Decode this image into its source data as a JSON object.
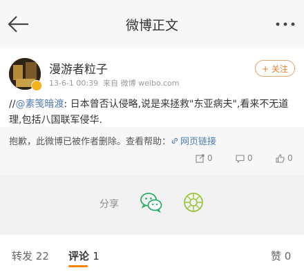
{
  "header": {
    "title": "微博正文"
  },
  "post": {
    "user_name": "漫游者粒子",
    "time": "13-6-1 00:39",
    "source_prefix": "来自",
    "source": "微博 weibo.com",
    "follow_label": "+ 关注",
    "text_prefix": "//",
    "mention": "@素笺暗渡",
    "text_body": ": 日本曾否认侵略,说是来拯救\"东亚病夫\",看来不无道理,包括八国联军侵华.",
    "deleted_notice": "抱歉，此微博已被作者删除。查看帮助：",
    "help_link_label": "网页链接",
    "actions": {
      "repost_count": "0",
      "comment_count": "0",
      "like_count": "0"
    }
  },
  "share": {
    "label": "分享",
    "wechat_icon": "wechat-icon",
    "moments_icon": "moments-icon"
  },
  "tabs": {
    "repost_label": "转发",
    "repost_count": "22",
    "comment_label": "评论",
    "comment_count": "1",
    "like_label": "赞",
    "like_count": "0"
  },
  "colors": {
    "accent": "#ff8200",
    "link": "#507daf",
    "follow": "#e87f2e",
    "wechat": "#2aae67",
    "moments": "#9bc53d"
  }
}
